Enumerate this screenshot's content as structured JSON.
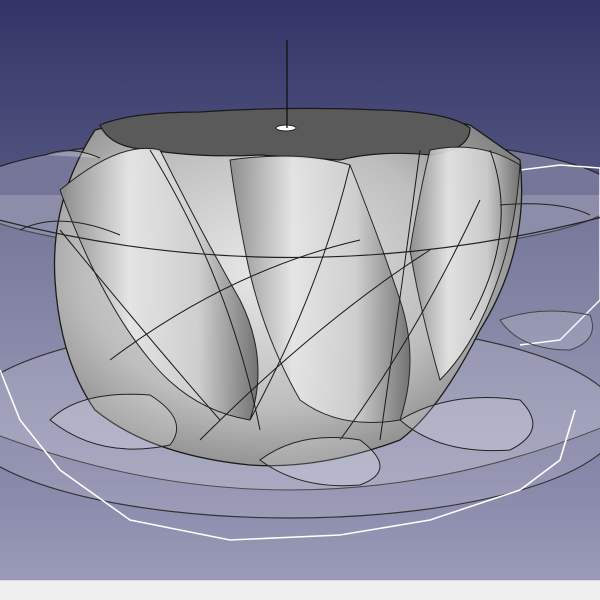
{
  "viewport": {
    "background_top": "#323466",
    "background_bottom": "#9898b6",
    "model": {
      "description_icon": "helical-gear-3d-model",
      "solid_color": "#d6d6d6",
      "housing_color": "#e4e4ec",
      "edge_color": "#1a1a1a",
      "wireframe_color": "#ffffff"
    }
  },
  "statusbar": {
    "background": "#efefef"
  }
}
